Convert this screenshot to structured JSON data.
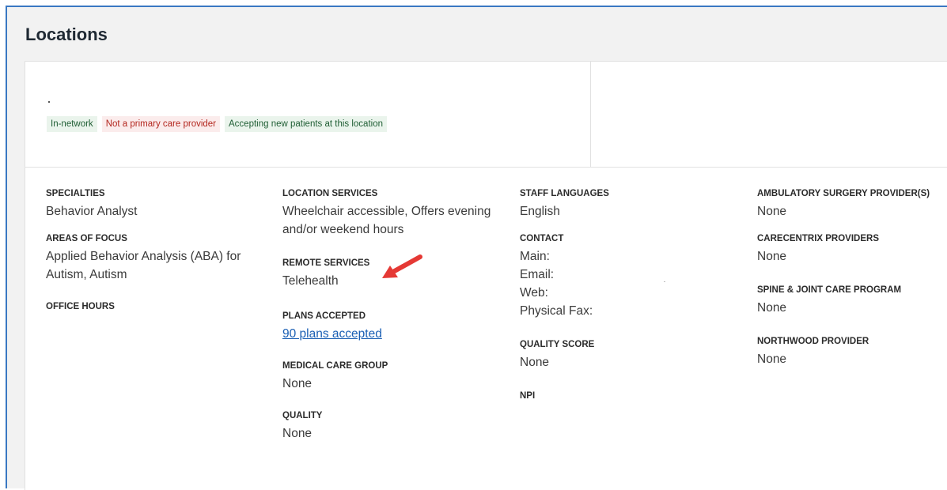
{
  "page": {
    "title": "Locations"
  },
  "badges": [
    {
      "label": "In-network",
      "color": "#1f5e34",
      "bg": "#eaf4ec"
    },
    {
      "label": "Not a primary care provider",
      "color": "#b3261e",
      "bg": "#fbecec"
    },
    {
      "label": "Accepting new patients at this location",
      "color": "#1f5e34",
      "bg": "#eaf4ec"
    }
  ],
  "details": {
    "specialties": {
      "label": "SPECIALTIES",
      "value": "Behavior Analyst"
    },
    "areas_of_focus": {
      "label": "AREAS OF FOCUS",
      "value": "Applied Behavior Analysis (ABA) for Autism,  Autism"
    },
    "office_hours": {
      "label": "OFFICE HOURS"
    },
    "location_services": {
      "label": "LOCATION SERVICES",
      "value": "Wheelchair accessible,  Offers evening and/or weekend hours"
    },
    "remote_services": {
      "label": "REMOTE SERVICES",
      "value": "Telehealth"
    },
    "plans_accepted": {
      "label": "PLANS ACCEPTED",
      "link": "90 plans accepted"
    },
    "medical_care_group": {
      "label": "MEDICAL CARE GROUP",
      "value": "None"
    },
    "quality": {
      "label": "QUALITY",
      "value": "None"
    },
    "staff_languages": {
      "label": "STAFF LANGUAGES",
      "value": "English"
    },
    "contact": {
      "label": "CONTACT",
      "main": "Main:",
      "email": "Email:",
      "web": "Web:",
      "physical_fax": "Physical Fax:"
    },
    "quality_score": {
      "label": "QUALITY SCORE",
      "value": "None"
    },
    "npi": {
      "label": "NPI"
    },
    "ambulatory": {
      "label": "AMBULATORY SURGERY PROVIDER(S)",
      "value": "None"
    },
    "carecentrix": {
      "label": "CARECENTRIX PROVIDERS",
      "value": "None"
    },
    "spine_joint": {
      "label": "SPINE & JOINT CARE PROGRAM",
      "value": "None"
    },
    "northwood": {
      "label": "NORTHWOOD PROVIDER",
      "value": "None"
    }
  },
  "annotation": {
    "arrow_color": "#e53935",
    "arrow_icon": "red-arrow-icon"
  },
  "colors": {
    "frame_border": "#3a78c2",
    "link": "#1a5fb4"
  }
}
